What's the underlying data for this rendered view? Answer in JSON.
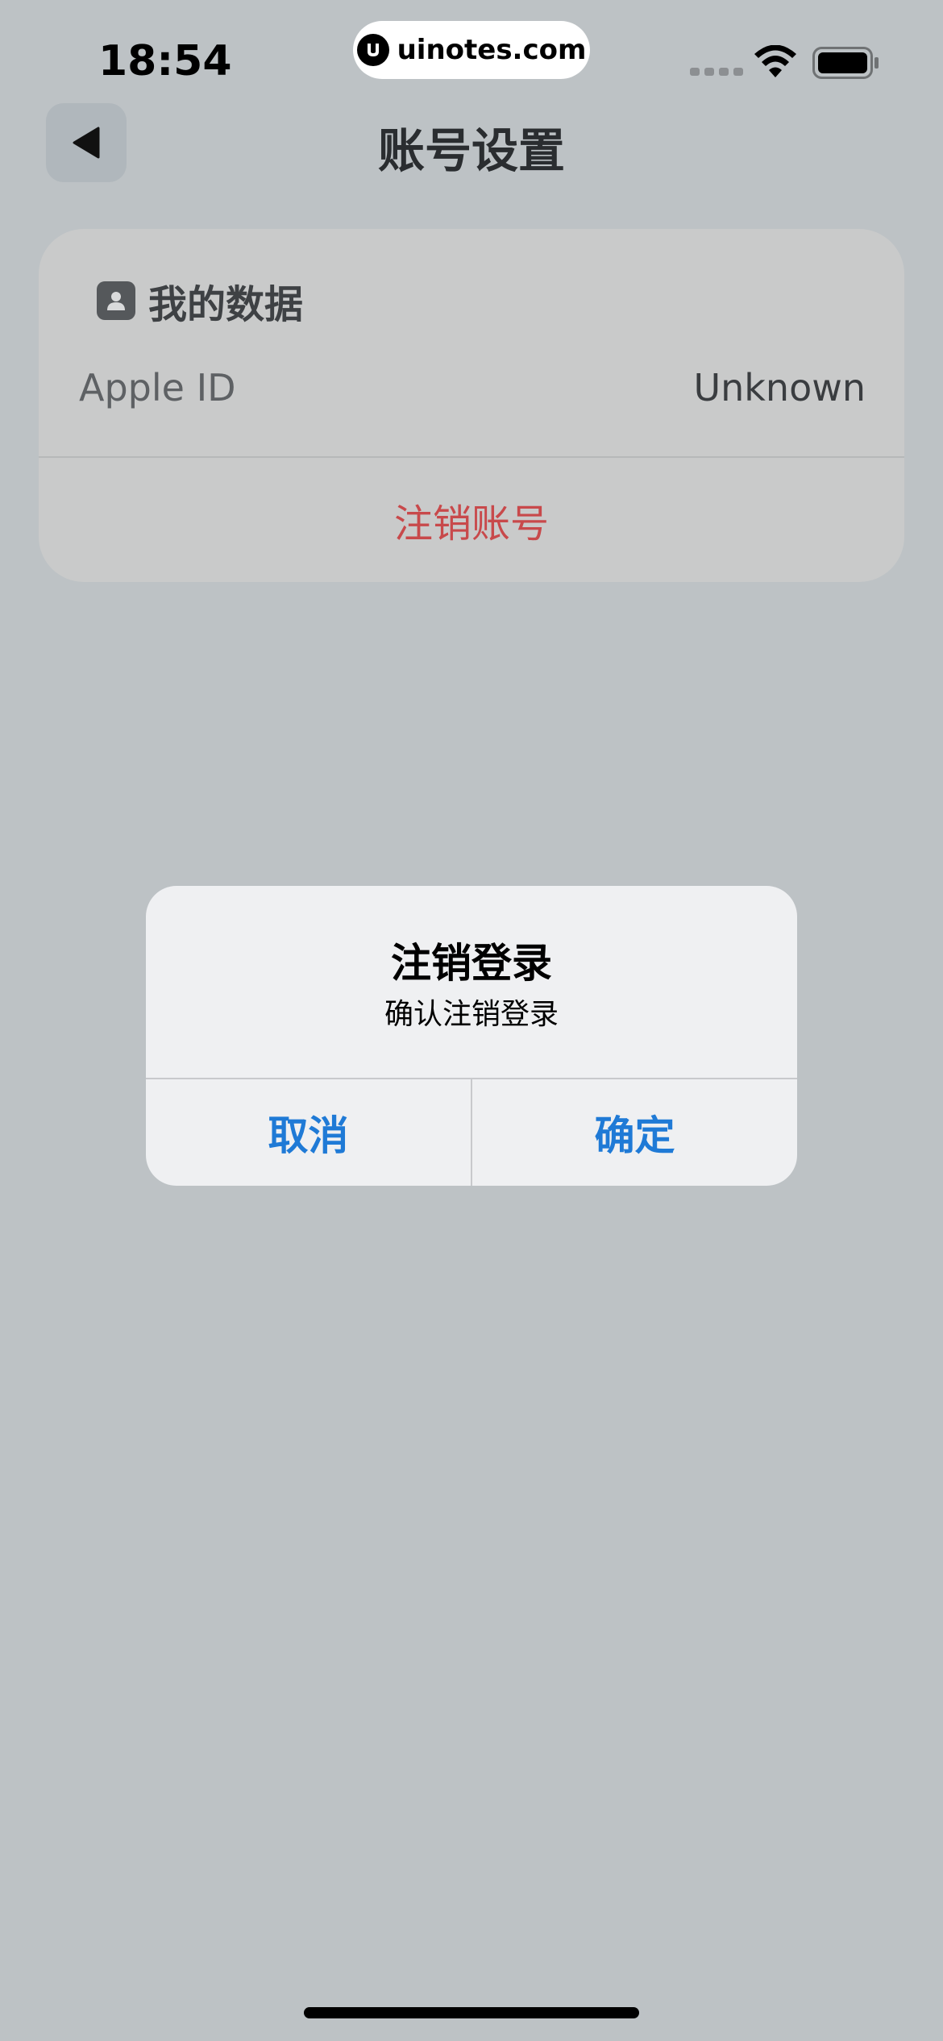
{
  "status_bar": {
    "time": "18:54",
    "watermark": "uinotes.com"
  },
  "nav": {
    "title": "账号设置",
    "back_icon": "back-triangle-icon"
  },
  "card": {
    "header_icon": "profile-icon",
    "header_label": "我的数据",
    "row": {
      "label": "Apple ID",
      "value": "Unknown"
    },
    "logout_account_label": "注销账号"
  },
  "alert": {
    "title": "注销登录",
    "message": "确认注销登录",
    "cancel_label": "取消",
    "confirm_label": "确定"
  },
  "colors": {
    "background": "#bdc2c5",
    "card": "#c9caca",
    "destructive": "#c8494b",
    "alert_button": "#1f7ad6"
  }
}
